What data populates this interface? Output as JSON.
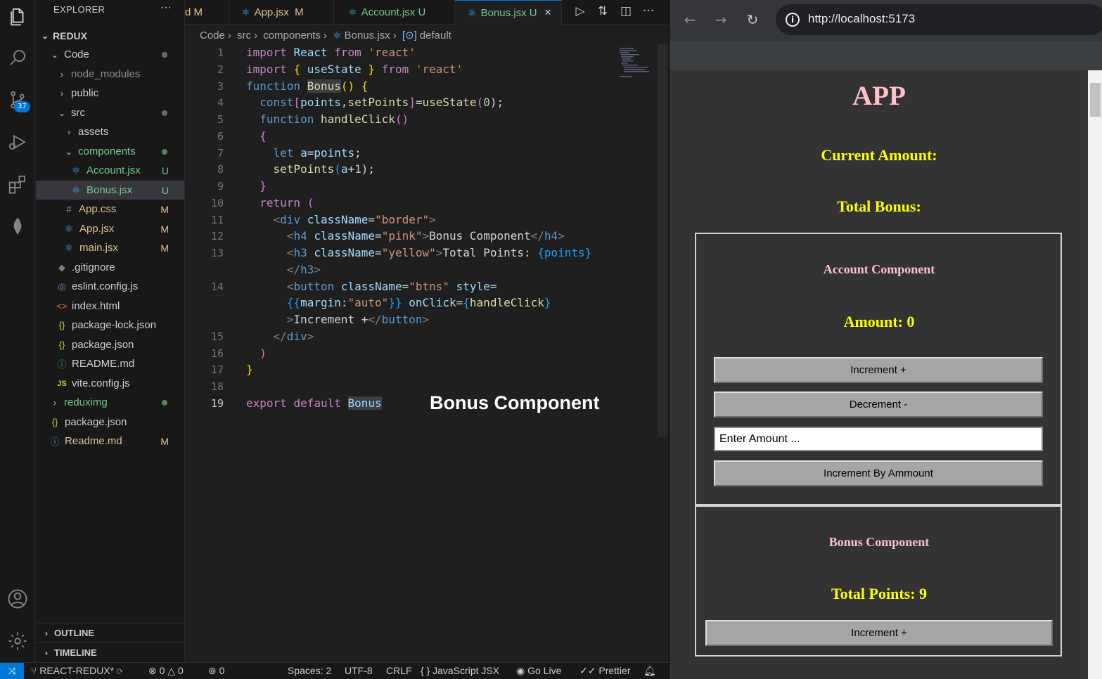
{
  "explorer": {
    "title": "EXPLORER",
    "more": "···",
    "root": "REDUX",
    "items": [
      {
        "label": "Code",
        "status": ""
      },
      {
        "label": "node_modules",
        "status": ""
      },
      {
        "label": "public",
        "status": ""
      },
      {
        "label": "src",
        "status": ""
      },
      {
        "label": "assets",
        "status": ""
      },
      {
        "label": "components",
        "status": ""
      },
      {
        "label": "Account.jsx",
        "status": "U"
      },
      {
        "label": "Bonus.jsx",
        "status": "U"
      },
      {
        "label": "App.css",
        "status": "M"
      },
      {
        "label": "App.jsx",
        "status": "M"
      },
      {
        "label": "main.jsx",
        "status": "M"
      },
      {
        "label": ".gitignore",
        "status": ""
      },
      {
        "label": "eslint.config.js",
        "status": ""
      },
      {
        "label": "index.html",
        "status": ""
      },
      {
        "label": "package-lock.json",
        "status": ""
      },
      {
        "label": "package.json",
        "status": ""
      },
      {
        "label": "README.md",
        "status": ""
      },
      {
        "label": "vite.config.js",
        "status": ""
      },
      {
        "label": "reduximg",
        "status": ""
      },
      {
        "label": "package.json",
        "status": ""
      },
      {
        "label": "Readme.md",
        "status": "M"
      }
    ],
    "sections": [
      "OUTLINE",
      "TIMELINE"
    ],
    "source_control_badge": "37"
  },
  "tabs": [
    {
      "label": "d",
      "status": "M"
    },
    {
      "label": "App.jsx",
      "status": "M"
    },
    {
      "label": "Account.jsx",
      "status": "U"
    },
    {
      "label": "Bonus.jsx",
      "status": "U",
      "close": "✕"
    }
  ],
  "breadcrumb": [
    "Code",
    "src",
    "components",
    "Bonus.jsx",
    "default"
  ],
  "editor": {
    "line_numbers": [
      "1",
      "2",
      "3",
      "4",
      "5",
      "6",
      "7",
      "8",
      "9",
      "10",
      "11",
      "12",
      "13",
      "14",
      "15",
      "16",
      "17",
      "18",
      "19"
    ],
    "ghost_text": "Bonus Component",
    "code": {
      "l1_a": "import",
      "l1_b": "React",
      "l1_c": "from",
      "l1_d": "'react'",
      "l2_a": "import",
      "l2_b": "{",
      "l2_c": "useState",
      "l2_d": "}",
      "l2_e": "from",
      "l2_f": "'react'",
      "l3_a": "function",
      "l3_b": "Bonus",
      "l3_c": "()",
      "l3_d": "{",
      "l4_a": "const",
      "l4_b": "[",
      "l4_c": "points",
      "l4_d": ",",
      "l4_e": "setPoints",
      "l4_f": "]",
      "l4_g": "=",
      "l4_h": "useState",
      "l4_i": "(",
      "l4_j": "0",
      "l4_k": ");",
      "l5_a": "function",
      "l5_b": "handleClick",
      "l5_c": "()",
      "l6_a": "{",
      "l7_a": "let",
      "l7_b": "a",
      "l7_c": "=",
      "l7_d": "points",
      "l7_e": ";",
      "l8_a": "setPoints",
      "l8_b": "(",
      "l8_c": "a",
      "l8_d": "+",
      "l8_e": "1",
      "l8_f": ");",
      "l9_a": "}",
      "l10_a": "return",
      "l10_b": "(",
      "l11_a": "<",
      "l11_b": "div",
      "l11_c": "className",
      "l11_d": "=",
      "l11_e": "\"border\"",
      "l11_f": ">",
      "l12_a": "<",
      "l12_b": "h4",
      "l12_c": "className",
      "l12_d": "=",
      "l12_e": "\"pink\"",
      "l12_f": ">",
      "l12_g": "Bonus Component",
      "l12_h": "</",
      "l12_i": "h4",
      "l12_j": ">",
      "l13_a": "<",
      "l13_b": "h3",
      "l13_c": "className",
      "l13_d": "=",
      "l13_e": "\"yellow\"",
      "l13_f": ">",
      "l13_g": "Total Points: ",
      "l13_h": "{points}",
      "l13w_a": "</",
      "l13w_b": "h3",
      "l13w_c": ">",
      "l14_a": "<",
      "l14_b": "button",
      "l14_c": "className",
      "l14_d": "=",
      "l14_e": "\"btns\"",
      "l14_f": "style",
      "l14_g": "=",
      "l14w1_a": "{{",
      "l14w1_b": "margin",
      "l14w1_c": ":",
      "l14w1_d": "\"auto\"",
      "l14w1_e": "}}",
      "l14w1_f": "onClick",
      "l14w1_g": "=",
      "l14w1_h": "{",
      "l14w1_i": "handleClick",
      "l14w1_j": "}",
      "l14w2_a": ">",
      "l14w2_b": "Increment +",
      "l14w2_c": "</",
      "l14w2_d": "button",
      "l14w2_e": ">",
      "l15_a": "</",
      "l15_b": "div",
      "l15_c": ">",
      "l16_a": ")",
      "l17_a": "}",
      "l19_a": "export",
      "l19_b": "default",
      "l19_c": "Bonus"
    }
  },
  "statusbar": {
    "branch": "REACT-REDUX*",
    "errors": "0",
    "warnings": "0",
    "ports": "0",
    "spaces": "Spaces: 2",
    "encoding": "UTF-8",
    "eol": "CRLF",
    "language": "JavaScript JSX",
    "golive": "Go Live",
    "prettier": "Prettier"
  },
  "browser": {
    "url": "http://localhost:5173",
    "app_title": "APP",
    "current_amount": "Current Amount:",
    "total_bonus": "Total Bonus:",
    "account": {
      "title": "Account Component",
      "amount": "Amount: 0",
      "increment": "Increment +",
      "decrement": "Decrement -",
      "input_placeholder": "Enter Amount ...",
      "increment_by_amount": "Increment By Ammount"
    },
    "bonus": {
      "title": "Bonus Component",
      "total_points": "Total Points: 9",
      "increment": "Increment +"
    }
  },
  "colors": {
    "accent": "#0078d4",
    "pink": "#ffc0cb",
    "yellow": "#ffff00",
    "modified": "#e2c08d",
    "untracked": "#73c991"
  }
}
